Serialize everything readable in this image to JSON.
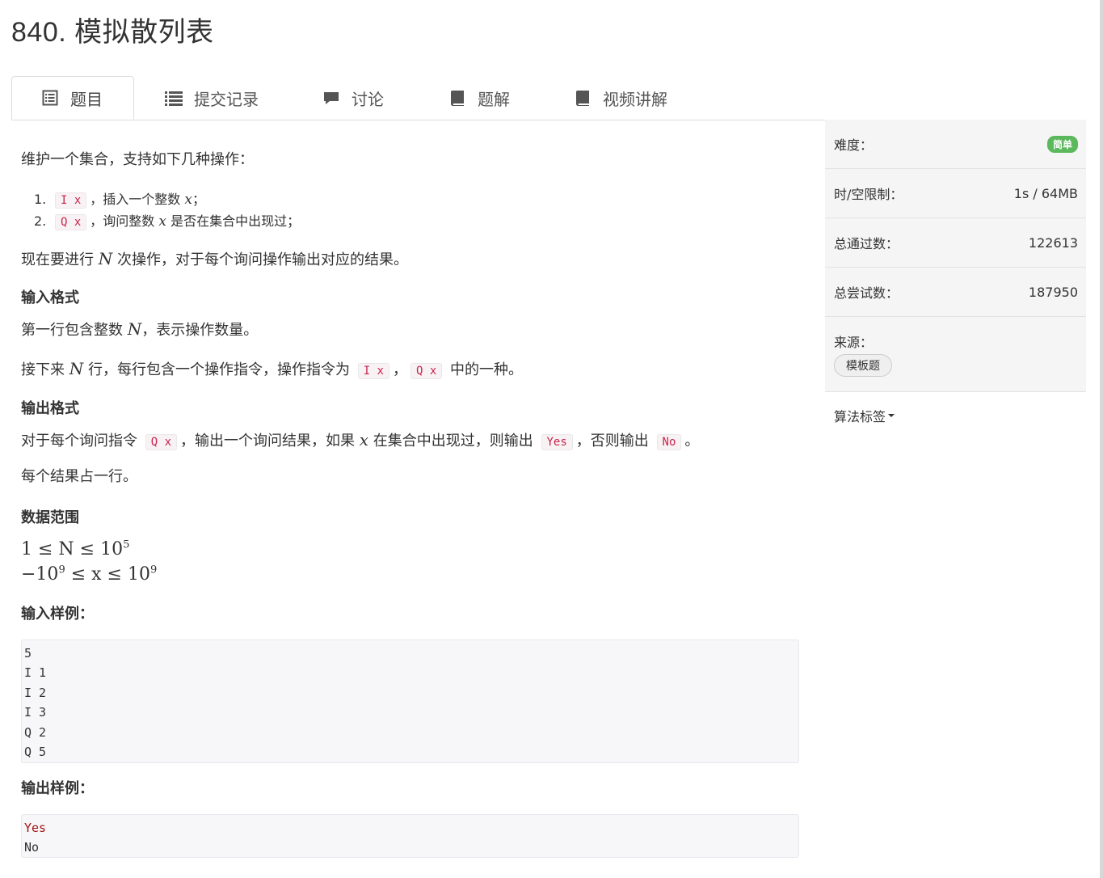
{
  "problem": {
    "title": "840. 模拟散列表"
  },
  "tabs": [
    {
      "label": "题目",
      "icon": "list-alt-icon"
    },
    {
      "label": "提交记录",
      "icon": "list-icon"
    },
    {
      "label": "讨论",
      "icon": "comment-icon"
    },
    {
      "label": "题解",
      "icon": "book-icon"
    },
    {
      "label": "视频讲解",
      "icon": "book-icon"
    }
  ],
  "description": {
    "intro": "维护一个集合，支持如下几种操作：",
    "ops": [
      {
        "num": "1.",
        "code": "I x",
        "text_a": "，插入一个整数 ",
        "var": "x",
        "text_b": "；"
      },
      {
        "num": "2.",
        "code": "Q x",
        "text_a": "，询问整数 ",
        "var": "x",
        "text_b": " 是否在集合中出现过；"
      }
    ],
    "task_a": "现在要进行 ",
    "task_var": "N",
    "task_b": " 次操作，对于每个询问操作输出对应的结果。",
    "input_heading": "输入格式",
    "input_line1_a": "第一行包含整数 ",
    "input_line1_var": "N",
    "input_line1_b": "，表示操作数量。",
    "input_line2_a": "接下来 ",
    "input_line2_var": "N",
    "input_line2_b": " 行，每行包含一个操作指令，操作指令为 ",
    "input_line2_code1": "I x",
    "input_line2_sep": "，",
    "input_line2_code2": "Q x",
    "input_line2_c": " 中的一种。",
    "output_heading": "输出格式",
    "output_line1_a": "对于每个询问指令 ",
    "output_line1_code": "Q x",
    "output_line1_b": "，输出一个询问结果，如果 ",
    "output_line1_var": "x",
    "output_line1_c": " 在集合中出现过，则输出 ",
    "output_line1_yes": "Yes",
    "output_line1_d": "，否则输出 ",
    "output_line1_no": "No",
    "output_line1_e": "。",
    "output_line2": "每个结果占一行。",
    "range_heading": "数据范围",
    "range_line1": "1 ≤ N ≤ 10",
    "range_line1_exp": "5",
    "range_line2_a": "−10",
    "range_line2_exp1": "9",
    "range_line2_b": " ≤ x ≤ 10",
    "range_line2_exp2": "9",
    "sample_in_heading": "输入样例：",
    "sample_in": [
      "5",
      "I 1",
      "I 2",
      "I 3",
      "Q 2",
      "Q 5"
    ],
    "sample_out_heading": "输出样例：",
    "sample_out": [
      "Yes",
      "No"
    ]
  },
  "sidebar": {
    "difficulty_label": "难度：",
    "difficulty_value": "简单",
    "limit_label": "时/空限制：",
    "limit_value": "1s / 64MB",
    "passed_label": "总通过数：",
    "passed_value": "122613",
    "tried_label": "总尝试数：",
    "tried_value": "187950",
    "source_label": "来源：",
    "source_tag": "模板题",
    "algo_label": "算法标签"
  },
  "colors": {
    "badge": "#5cb85c",
    "code_text": "#c7254e",
    "code_bg": "#f9f2f4"
  }
}
